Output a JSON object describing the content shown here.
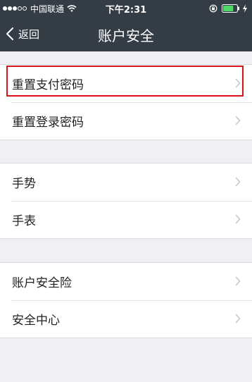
{
  "status_bar": {
    "signal_filled": 3,
    "signal_total": 5,
    "carrier": "中国联通",
    "time": "下午2:31",
    "battery_level": 0.75,
    "battery_color": "#4cd964"
  },
  "nav": {
    "back_label": "返回",
    "title": "账户安全"
  },
  "groups": [
    {
      "items": [
        {
          "label": "重置支付密码",
          "highlighted": true
        },
        {
          "label": "重置登录密码"
        }
      ]
    },
    {
      "items": [
        {
          "label": "手势"
        },
        {
          "label": "手表"
        }
      ]
    },
    {
      "items": [
        {
          "label": "账户安全险"
        },
        {
          "label": "安全中心"
        }
      ]
    }
  ],
  "colors": {
    "nav_background": "#343c46",
    "page_background": "#f0eff4",
    "highlight_border": "#d9151b"
  }
}
